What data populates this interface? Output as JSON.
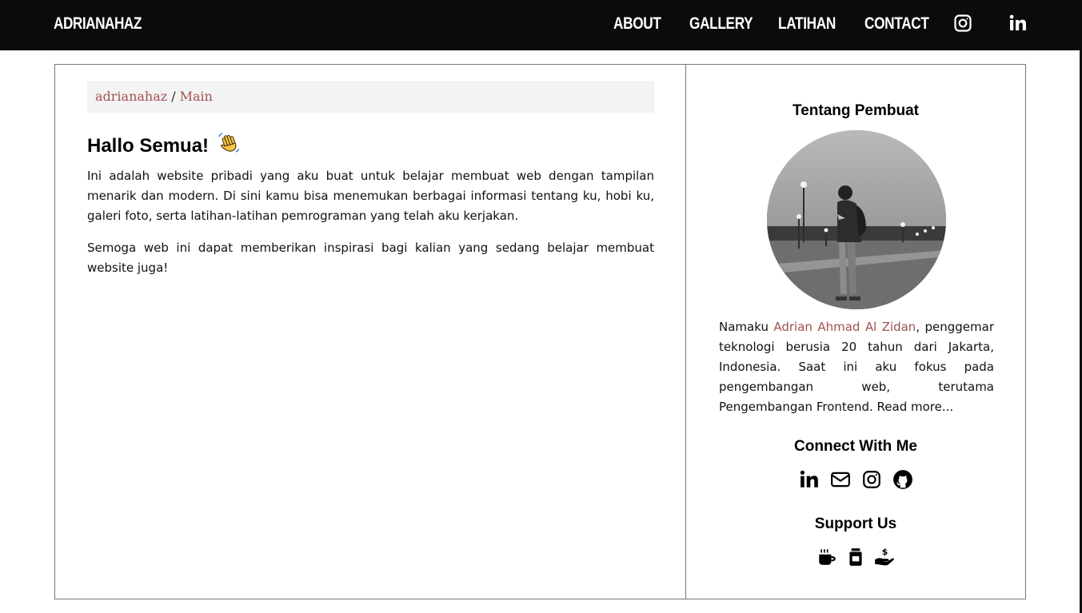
{
  "nav": {
    "brand": "ADRIANAHAZ",
    "links": [
      {
        "label": "ABOUT"
      },
      {
        "label": "GALLERY"
      },
      {
        "label": "LATIHAN"
      },
      {
        "label": "CONTACT"
      }
    ],
    "icons": [
      "instagram-icon",
      "linkedin-icon"
    ]
  },
  "breadcrumb": {
    "home": "adrianahaz",
    "separator": "/",
    "current": "Main"
  },
  "main": {
    "heading": "Hallo Semua!",
    "heading_emoji": "waving-hand-icon",
    "paragraphs": [
      "Ini adalah website pribadi yang aku buat untuk belajar membuat web dengan tampilan menarik dan modern. Di sini kamu bisa menemukan berbagai informasi tentang ku, hobi ku, galeri foto, serta latihan-latihan pemrograman yang telah aku kerjakan.",
      "Semoga web ini dapat memberikan inspirasi bagi kalian yang sedang belajar membuat website juga!"
    ]
  },
  "sidebar": {
    "about_title": "Tentang Pembuat",
    "bio_prefix": "Namaku ",
    "bio_name": "Adrian Ahmad Al Zidan",
    "bio_suffix": ", penggemar teknologi berusia 20 tahun dari Jakarta, Indonesia. Saat ini aku fokus pada pengembangan web, terutama Pengembangan Frontend. Read more...",
    "connect_title": "Connect With Me",
    "connect_icons": [
      "linkedin-icon",
      "mail-icon",
      "instagram-icon",
      "github-icon"
    ],
    "support_title": "Support Us",
    "support_icons": [
      "coffee-icon",
      "jar-icon",
      "donate-hand-icon"
    ]
  },
  "colors": {
    "navbar_bg": "#0b0b0b",
    "accent": "#a05252",
    "breadcrumb_bg": "#f3f3f3"
  }
}
